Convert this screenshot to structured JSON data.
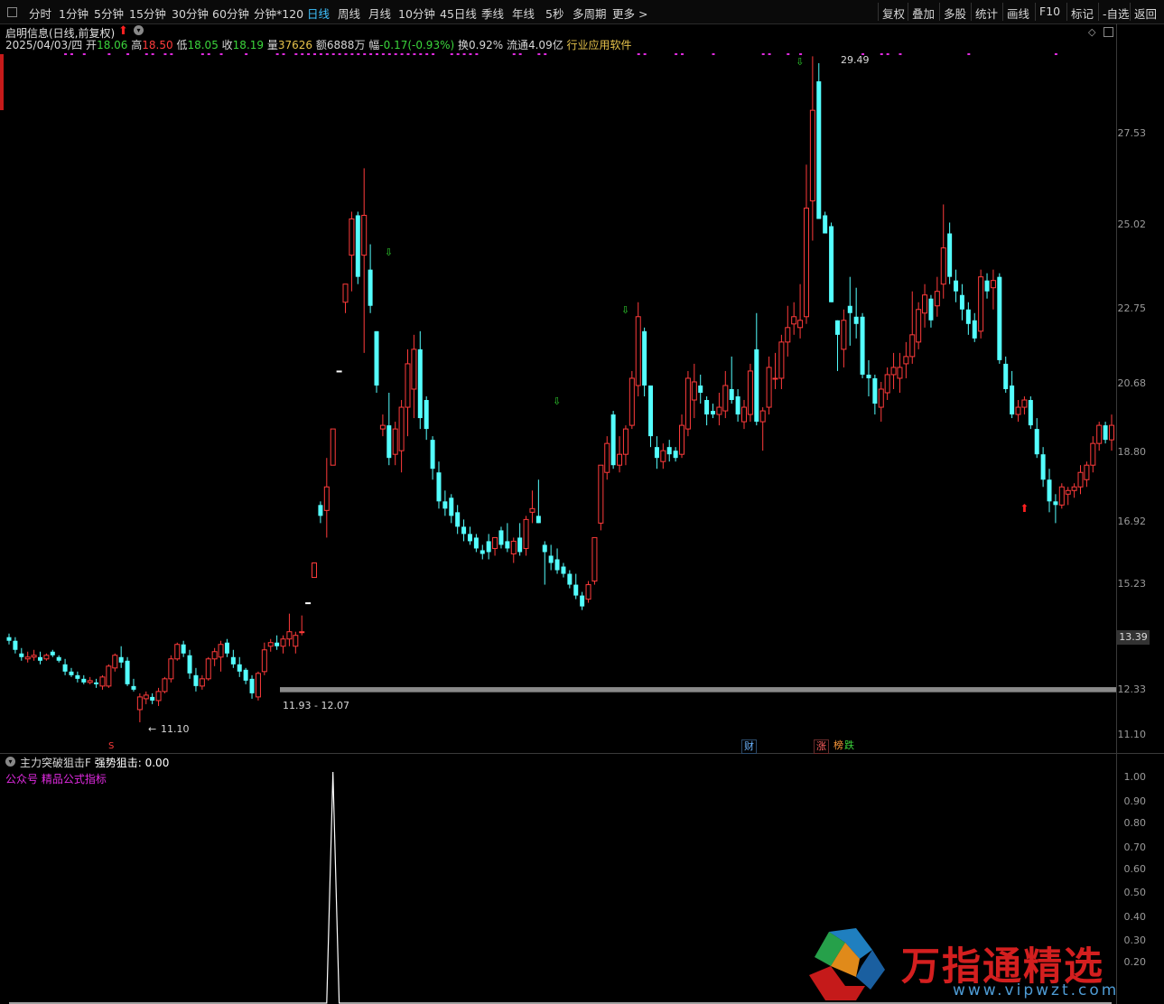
{
  "toolbar": {
    "tabs": [
      "分时",
      "1分钟",
      "5分钟",
      "15分钟",
      "30分钟",
      "60分钟",
      "分钟*120",
      "日线",
      "周线",
      "月线",
      "10分钟",
      "45日线",
      "季线",
      "年线",
      "5秒",
      "多周期",
      "更多 >"
    ],
    "active_tab": "日线",
    "right_buttons": [
      "复权",
      "叠加",
      "多股",
      "统计",
      "画线",
      "F10",
      "标记",
      "-自选",
      "返回"
    ]
  },
  "header": {
    "title": "启明信息(日线,前复权)",
    "date": "2025/04/03/四",
    "open_label": "开",
    "open": "18.06",
    "high_label": "高",
    "high": "18.50",
    "low_label": "低",
    "low": "18.05",
    "close_label": "收",
    "close": "18.19",
    "volume_label": "量",
    "volume": "37626",
    "amount_label": "额",
    "amount": "6888万",
    "change_label": "幅",
    "change": "-0.17(-0.93%)",
    "turnover_label": "换",
    "turnover": "0.92%",
    "float_label": "流通",
    "float": "4.09亿",
    "industry": "行业应用软件"
  },
  "price_axis": {
    "labels": [
      "27.53",
      "25.02",
      "22.75",
      "20.68",
      "18.80",
      "16.92",
      "15.23",
      "13.39",
      "12.33",
      "11.10"
    ],
    "current_price": "13.39"
  },
  "annotations": {
    "max_price": "29.49",
    "min_price": "11.10",
    "zone_label": "11.93 - 12.07"
  },
  "event_badges": {
    "finance": "财",
    "limit_up": "涨",
    "dragon_tiger": "榜",
    "fall": "跌",
    "marker_s": "S"
  },
  "indicator": {
    "name": "主力突破狙击F",
    "param_label": "强势狙击:",
    "param_value": "0.00",
    "subtitle": "公众号 精品公式指标",
    "axis_labels": [
      "1.00",
      "0.90",
      "0.80",
      "0.70",
      "0.60",
      "0.50",
      "0.40",
      "0.30",
      "0.20"
    ]
  },
  "watermark": {
    "text": "万指通精选",
    "url": "www.vipwzt.com"
  },
  "colors": {
    "up": "#ff3b3b",
    "down": "#54ffff",
    "active_tab": "#3fc2ff",
    "magenta": "#e02ae0",
    "arrow_green": "#2ed12e"
  },
  "chart_data": {
    "type": "candlestick",
    "price_range": [
      10.8,
      29.6
    ],
    "candles": [
      {
        "o": 13.45,
        "h": 13.55,
        "l": 13.25,
        "c": 13.35
      },
      {
        "o": 13.35,
        "h": 13.45,
        "l": 13.0,
        "c": 13.1
      },
      {
        "o": 13.0,
        "h": 13.15,
        "l": 12.8,
        "c": 12.9
      },
      {
        "o": 12.85,
        "h": 13.05,
        "l": 12.75,
        "c": 12.9
      },
      {
        "o": 12.9,
        "h": 13.1,
        "l": 12.8,
        "c": 12.95
      },
      {
        "o": 12.9,
        "h": 13.05,
        "l": 12.7,
        "c": 12.8
      },
      {
        "o": 12.85,
        "h": 13.0,
        "l": 12.8,
        "c": 12.95
      },
      {
        "o": 13.05,
        "h": 13.1,
        "l": 12.9,
        "c": 12.95
      },
      {
        "o": 12.9,
        "h": 12.95,
        "l": 12.75,
        "c": 12.8
      },
      {
        "o": 12.7,
        "h": 12.85,
        "l": 12.4,
        "c": 12.5
      },
      {
        "o": 12.5,
        "h": 12.6,
        "l": 12.35,
        "c": 12.4
      },
      {
        "o": 12.4,
        "h": 12.5,
        "l": 12.2,
        "c": 12.3
      },
      {
        "o": 12.3,
        "h": 12.4,
        "l": 12.15,
        "c": 12.2
      },
      {
        "o": 12.2,
        "h": 12.35,
        "l": 12.15,
        "c": 12.25
      },
      {
        "o": 12.2,
        "h": 12.3,
        "l": 12.05,
        "c": 12.15
      },
      {
        "o": 12.1,
        "h": 12.4,
        "l": 12.0,
        "c": 12.35
      },
      {
        "o": 12.1,
        "h": 12.7,
        "l": 12.05,
        "c": 12.65
      },
      {
        "o": 12.6,
        "h": 13.0,
        "l": 12.5,
        "c": 12.95
      },
      {
        "o": 12.9,
        "h": 13.2,
        "l": 12.6,
        "c": 12.75
      },
      {
        "o": 12.8,
        "h": 12.9,
        "l": 12.1,
        "c": 12.15
      },
      {
        "o": 12.1,
        "h": 12.3,
        "l": 11.95,
        "c": 12.0
      },
      {
        "o": 11.45,
        "h": 11.9,
        "l": 11.1,
        "c": 11.8
      },
      {
        "o": 11.75,
        "h": 11.95,
        "l": 11.6,
        "c": 11.85
      },
      {
        "o": 11.8,
        "h": 11.9,
        "l": 11.6,
        "c": 11.7
      },
      {
        "o": 11.7,
        "h": 12.05,
        "l": 11.55,
        "c": 11.95
      },
      {
        "o": 11.95,
        "h": 12.35,
        "l": 11.9,
        "c": 12.3
      },
      {
        "o": 12.3,
        "h": 12.95,
        "l": 12.2,
        "c": 12.85
      },
      {
        "o": 12.85,
        "h": 13.3,
        "l": 12.8,
        "c": 13.25
      },
      {
        "o": 13.25,
        "h": 13.35,
        "l": 12.9,
        "c": 13.0
      },
      {
        "o": 12.95,
        "h": 13.1,
        "l": 12.3,
        "c": 12.45
      },
      {
        "o": 12.4,
        "h": 12.6,
        "l": 11.95,
        "c": 12.1
      },
      {
        "o": 12.1,
        "h": 12.4,
        "l": 12.0,
        "c": 12.3
      },
      {
        "o": 12.3,
        "h": 12.9,
        "l": 12.25,
        "c": 12.85
      },
      {
        "o": 12.85,
        "h": 13.15,
        "l": 12.65,
        "c": 13.05
      },
      {
        "o": 12.9,
        "h": 13.35,
        "l": 12.5,
        "c": 13.25
      },
      {
        "o": 13.3,
        "h": 13.4,
        "l": 12.9,
        "c": 13.0
      },
      {
        "o": 12.9,
        "h": 13.1,
        "l": 12.6,
        "c": 12.7
      },
      {
        "o": 12.7,
        "h": 12.9,
        "l": 12.35,
        "c": 12.5
      },
      {
        "o": 12.55,
        "h": 12.6,
        "l": 12.15,
        "c": 12.25
      },
      {
        "o": 12.3,
        "h": 12.4,
        "l": 11.75,
        "c": 11.9
      },
      {
        "o": 11.8,
        "h": 12.5,
        "l": 11.7,
        "c": 12.45
      },
      {
        "o": 12.5,
        "h": 13.3,
        "l": 12.4,
        "c": 13.1
      },
      {
        "o": 13.2,
        "h": 13.4,
        "l": 13.05,
        "c": 13.3
      },
      {
        "o": 13.3,
        "h": 13.5,
        "l": 13.1,
        "c": 13.2
      },
      {
        "o": 13.2,
        "h": 13.5,
        "l": 13.0,
        "c": 13.4
      },
      {
        "o": 13.4,
        "h": 14.1,
        "l": 13.2,
        "c": 13.6
      },
      {
        "o": 13.2,
        "h": 13.6,
        "l": 13.0,
        "c": 13.5
      },
      {
        "o": 13.6,
        "h": 14.05,
        "l": 13.5,
        "c": 13.6
      },
      {
        "o": 14.4,
        "h": 14.4,
        "l": 14.4,
        "c": 14.4
      },
      {
        "o": 15.1,
        "h": 15.5,
        "l": 15.1,
        "c": 15.5
      },
      {
        "o": 17.1,
        "h": 17.2,
        "l": 16.6,
        "c": 16.8
      },
      {
        "o": 16.95,
        "h": 18.4,
        "l": 16.2,
        "c": 17.6
      },
      {
        "o": 18.2,
        "h": 19.2,
        "l": 18.2,
        "c": 19.2
      },
      {
        "o": 20.8,
        "h": 20.8,
        "l": 20.8,
        "c": 20.8
      },
      {
        "o": 22.7,
        "h": 23.2,
        "l": 22.4,
        "c": 23.2
      },
      {
        "o": 24.0,
        "h": 25.2,
        "l": 23.0,
        "c": 25.0
      },
      {
        "o": 25.1,
        "h": 25.2,
        "l": 23.2,
        "c": 23.4
      },
      {
        "o": 24.0,
        "h": 26.4,
        "l": 21.3,
        "c": 25.1
      },
      {
        "o": 23.6,
        "h": 24.3,
        "l": 22.4,
        "c": 22.6
      },
      {
        "o": 21.9,
        "h": 21.9,
        "l": 20.2,
        "c": 20.4
      },
      {
        "o": 19.2,
        "h": 19.6,
        "l": 19.0,
        "c": 19.3
      },
      {
        "o": 19.3,
        "h": 20.2,
        "l": 18.2,
        "c": 18.4
      },
      {
        "o": 18.5,
        "h": 19.4,
        "l": 18.2,
        "c": 19.2
      },
      {
        "o": 18.6,
        "h": 20.0,
        "l": 18.0,
        "c": 19.8
      },
      {
        "o": 19.8,
        "h": 21.4,
        "l": 19.0,
        "c": 21.0
      },
      {
        "o": 20.3,
        "h": 21.8,
        "l": 19.5,
        "c": 21.4
      },
      {
        "o": 21.4,
        "h": 21.9,
        "l": 19.2,
        "c": 19.5
      },
      {
        "o": 20.0,
        "h": 20.1,
        "l": 18.9,
        "c": 19.2
      },
      {
        "o": 18.9,
        "h": 19.0,
        "l": 17.8,
        "c": 18.1
      },
      {
        "o": 18.0,
        "h": 18.3,
        "l": 17.0,
        "c": 17.2
      },
      {
        "o": 17.2,
        "h": 17.5,
        "l": 16.8,
        "c": 17.0
      },
      {
        "o": 17.3,
        "h": 17.4,
        "l": 16.6,
        "c": 16.8
      },
      {
        "o": 16.9,
        "h": 17.1,
        "l": 16.3,
        "c": 16.5
      },
      {
        "o": 16.5,
        "h": 16.7,
        "l": 16.1,
        "c": 16.3
      },
      {
        "o": 16.3,
        "h": 16.5,
        "l": 16.0,
        "c": 16.1
      },
      {
        "o": 16.2,
        "h": 16.3,
        "l": 15.8,
        "c": 15.9
      },
      {
        "o": 15.85,
        "h": 16.0,
        "l": 15.6,
        "c": 15.75
      },
      {
        "o": 16.1,
        "h": 16.3,
        "l": 15.6,
        "c": 15.8
      },
      {
        "o": 15.9,
        "h": 16.2,
        "l": 15.7,
        "c": 16.2
      },
      {
        "o": 16.4,
        "h": 16.5,
        "l": 15.9,
        "c": 16.0
      },
      {
        "o": 16.1,
        "h": 16.6,
        "l": 15.8,
        "c": 15.9
      },
      {
        "o": 15.75,
        "h": 16.2,
        "l": 15.5,
        "c": 16.1
      },
      {
        "o": 16.2,
        "h": 16.6,
        "l": 15.7,
        "c": 15.8
      },
      {
        "o": 15.9,
        "h": 16.8,
        "l": 15.7,
        "c": 16.7
      },
      {
        "o": 16.9,
        "h": 17.5,
        "l": 16.6,
        "c": 17.0
      },
      {
        "o": 16.8,
        "h": 17.8,
        "l": 16.6,
        "c": 16.6
      },
      {
        "o": 16.0,
        "h": 16.1,
        "l": 14.9,
        "c": 15.8
      },
      {
        "o": 15.7,
        "h": 16.0,
        "l": 15.3,
        "c": 15.5
      },
      {
        "o": 15.6,
        "h": 15.9,
        "l": 15.2,
        "c": 15.3
      },
      {
        "o": 15.4,
        "h": 15.5,
        "l": 15.1,
        "c": 15.2
      },
      {
        "o": 15.2,
        "h": 15.3,
        "l": 14.8,
        "c": 14.9
      },
      {
        "o": 14.9,
        "h": 15.2,
        "l": 14.5,
        "c": 14.6
      },
      {
        "o": 14.6,
        "h": 14.7,
        "l": 14.2,
        "c": 14.3
      },
      {
        "o": 14.5,
        "h": 15.0,
        "l": 14.4,
        "c": 14.9
      },
      {
        "o": 15.0,
        "h": 16.2,
        "l": 14.9,
        "c": 16.2
      },
      {
        "o": 16.6,
        "h": 18.2,
        "l": 16.4,
        "c": 18.2
      },
      {
        "o": 18.0,
        "h": 19.0,
        "l": 17.8,
        "c": 18.8
      },
      {
        "o": 19.6,
        "h": 19.7,
        "l": 18.1,
        "c": 18.2
      },
      {
        "o": 18.2,
        "h": 19.0,
        "l": 18.0,
        "c": 18.5
      },
      {
        "o": 18.5,
        "h": 19.3,
        "l": 18.2,
        "c": 19.2
      },
      {
        "o": 19.3,
        "h": 20.8,
        "l": 19.2,
        "c": 20.6
      },
      {
        "o": 20.4,
        "h": 22.7,
        "l": 20.1,
        "c": 22.3
      },
      {
        "o": 21.9,
        "h": 22.0,
        "l": 20.1,
        "c": 20.4
      },
      {
        "o": 20.4,
        "h": 20.4,
        "l": 18.7,
        "c": 19.0
      },
      {
        "o": 18.7,
        "h": 19.0,
        "l": 18.1,
        "c": 18.4
      },
      {
        "o": 18.3,
        "h": 18.8,
        "l": 18.1,
        "c": 18.6
      },
      {
        "o": 18.7,
        "h": 18.9,
        "l": 18.3,
        "c": 18.5
      },
      {
        "o": 18.6,
        "h": 18.7,
        "l": 18.3,
        "c": 18.4
      },
      {
        "o": 18.5,
        "h": 19.6,
        "l": 18.4,
        "c": 19.3
      },
      {
        "o": 19.2,
        "h": 20.8,
        "l": 19.0,
        "c": 20.6
      },
      {
        "o": 20.0,
        "h": 21.0,
        "l": 19.5,
        "c": 20.5
      },
      {
        "o": 20.4,
        "h": 20.7,
        "l": 19.9,
        "c": 20.2
      },
      {
        "o": 20.0,
        "h": 20.1,
        "l": 19.3,
        "c": 19.6
      },
      {
        "o": 19.7,
        "h": 19.9,
        "l": 19.5,
        "c": 19.6
      },
      {
        "o": 19.6,
        "h": 20.2,
        "l": 19.3,
        "c": 19.8
      },
      {
        "o": 19.7,
        "h": 20.8,
        "l": 19.5,
        "c": 20.4
      },
      {
        "o": 20.3,
        "h": 21.2,
        "l": 19.9,
        "c": 20.0
      },
      {
        "o": 20.1,
        "h": 20.3,
        "l": 19.4,
        "c": 19.6
      },
      {
        "o": 19.4,
        "h": 20.0,
        "l": 19.2,
        "c": 19.8
      },
      {
        "o": 19.6,
        "h": 21.0,
        "l": 19.4,
        "c": 20.8
      },
      {
        "o": 21.4,
        "h": 22.4,
        "l": 19.3,
        "c": 19.4
      },
      {
        "o": 19.4,
        "h": 19.8,
        "l": 18.6,
        "c": 19.7
      },
      {
        "o": 19.8,
        "h": 21.2,
        "l": 19.6,
        "c": 20.9
      },
      {
        "o": 20.6,
        "h": 21.3,
        "l": 20.3,
        "c": 20.6
      },
      {
        "o": 20.6,
        "h": 21.8,
        "l": 20.3,
        "c": 21.6
      },
      {
        "o": 21.6,
        "h": 22.6,
        "l": 21.2,
        "c": 22.0
      },
      {
        "o": 22.1,
        "h": 22.7,
        "l": 21.8,
        "c": 22.3
      },
      {
        "o": 22.0,
        "h": 23.2,
        "l": 21.7,
        "c": 22.2
      },
      {
        "o": 22.3,
        "h": 26.5,
        "l": 22.1,
        "c": 25.3
      },
      {
        "o": 25.5,
        "h": 29.49,
        "l": 24.4,
        "c": 28.0
      },
      {
        "o": 28.8,
        "h": 29.3,
        "l": 25.0,
        "c": 25.0
      },
      {
        "o": 25.1,
        "h": 25.2,
        "l": 24.6,
        "c": 24.6
      },
      {
        "o": 24.8,
        "h": 24.9,
        "l": 22.7,
        "c": 22.7
      },
      {
        "o": 22.2,
        "h": 22.2,
        "l": 20.8,
        "c": 21.8
      },
      {
        "o": 21.4,
        "h": 22.5,
        "l": 20.9,
        "c": 22.2
      },
      {
        "o": 22.6,
        "h": 23.4,
        "l": 21.5,
        "c": 22.4
      },
      {
        "o": 22.3,
        "h": 23.1,
        "l": 21.7,
        "c": 22.1
      },
      {
        "o": 22.3,
        "h": 22.4,
        "l": 20.6,
        "c": 20.7
      },
      {
        "o": 20.7,
        "h": 21.1,
        "l": 20.1,
        "c": 20.6
      },
      {
        "o": 20.6,
        "h": 20.7,
        "l": 19.6,
        "c": 19.9
      },
      {
        "o": 19.8,
        "h": 20.5,
        "l": 19.4,
        "c": 20.3
      },
      {
        "o": 20.2,
        "h": 20.9,
        "l": 20.0,
        "c": 20.7
      },
      {
        "o": 20.7,
        "h": 21.3,
        "l": 20.3,
        "c": 20.9
      },
      {
        "o": 20.6,
        "h": 21.3,
        "l": 20.2,
        "c": 20.9
      },
      {
        "o": 21.0,
        "h": 21.6,
        "l": 20.6,
        "c": 21.2
      },
      {
        "o": 21.2,
        "h": 23.0,
        "l": 21.0,
        "c": 21.8
      },
      {
        "o": 21.6,
        "h": 22.7,
        "l": 21.4,
        "c": 22.5
      },
      {
        "o": 22.4,
        "h": 23.2,
        "l": 22.0,
        "c": 22.9
      },
      {
        "o": 22.8,
        "h": 22.9,
        "l": 22.0,
        "c": 22.2
      },
      {
        "o": 22.6,
        "h": 23.4,
        "l": 22.3,
        "c": 23.0
      },
      {
        "o": 23.2,
        "h": 25.4,
        "l": 22.8,
        "c": 24.2
      },
      {
        "o": 24.6,
        "h": 24.9,
        "l": 23.2,
        "c": 23.4
      },
      {
        "o": 23.3,
        "h": 23.6,
        "l": 22.7,
        "c": 23.0
      },
      {
        "o": 22.9,
        "h": 23.2,
        "l": 22.2,
        "c": 22.5
      },
      {
        "o": 22.5,
        "h": 22.7,
        "l": 21.8,
        "c": 22.1
      },
      {
        "o": 22.2,
        "h": 22.4,
        "l": 21.6,
        "c": 21.7
      },
      {
        "o": 21.9,
        "h": 23.6,
        "l": 21.7,
        "c": 23.4
      },
      {
        "o": 23.3,
        "h": 23.5,
        "l": 22.8,
        "c": 23.0
      },
      {
        "o": 23.1,
        "h": 23.6,
        "l": 22.5,
        "c": 23.3
      },
      {
        "o": 23.4,
        "h": 23.5,
        "l": 21.0,
        "c": 21.1
      },
      {
        "o": 21.0,
        "h": 21.2,
        "l": 20.2,
        "c": 20.3
      },
      {
        "o": 20.4,
        "h": 20.8,
        "l": 19.5,
        "c": 19.6
      },
      {
        "o": 19.6,
        "h": 20.0,
        "l": 19.4,
        "c": 19.8
      },
      {
        "o": 19.8,
        "h": 20.1,
        "l": 19.6,
        "c": 20.0
      },
      {
        "o": 20.0,
        "h": 20.1,
        "l": 19.2,
        "c": 19.3
      },
      {
        "o": 19.2,
        "h": 19.5,
        "l": 18.4,
        "c": 18.5
      },
      {
        "o": 18.5,
        "h": 18.7,
        "l": 17.6,
        "c": 17.8
      },
      {
        "o": 17.8,
        "h": 18.1,
        "l": 16.9,
        "c": 17.2
      },
      {
        "o": 17.2,
        "h": 17.4,
        "l": 16.6,
        "c": 17.1
      },
      {
        "o": 17.1,
        "h": 17.7,
        "l": 17.0,
        "c": 17.6
      },
      {
        "o": 17.4,
        "h": 17.6,
        "l": 17.1,
        "c": 17.5
      },
      {
        "o": 17.5,
        "h": 17.7,
        "l": 17.3,
        "c": 17.6
      },
      {
        "o": 17.6,
        "h": 18.2,
        "l": 17.4,
        "c": 18.0
      },
      {
        "o": 17.8,
        "h": 18.3,
        "l": 17.6,
        "c": 18.2
      },
      {
        "o": 18.2,
        "h": 19.0,
        "l": 18.0,
        "c": 18.8
      },
      {
        "o": 18.8,
        "h": 19.4,
        "l": 18.6,
        "c": 19.3
      },
      {
        "o": 19.3,
        "h": 19.4,
        "l": 18.8,
        "c": 18.9
      },
      {
        "o": 18.9,
        "h": 19.6,
        "l": 18.6,
        "c": 19.3
      }
    ],
    "indicator_series": {
      "name": "强势狙击",
      "range": [
        0,
        1.0
      ],
      "spike_index": 52,
      "spike_value": 1.0
    }
  }
}
